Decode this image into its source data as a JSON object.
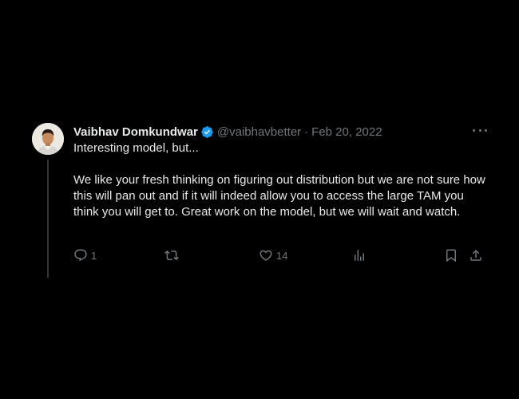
{
  "tweet": {
    "author_name": "Vaibhav Domkundwar",
    "handle": "@vaibhavbetter",
    "separator": "·",
    "date": "Feb 20, 2022",
    "text_line1": "Interesting model, but...",
    "text_para2": "We like your fresh thinking on figuring out distribution but we are not sure how this will pan out and if it will indeed allow you to access the large TAM you think you will get to. Great work on the model, but we will wait and watch."
  },
  "actions": {
    "replies": "1",
    "retweets": "",
    "likes": "14",
    "views": ""
  },
  "icons": {
    "verified": "verified-badge-icon",
    "more": "more-dots-icon",
    "reply": "reply-icon",
    "retweet": "retweet-icon",
    "like": "heart-icon",
    "views": "views-bar-chart-icon",
    "bookmark": "bookmark-icon",
    "share": "share-icon"
  },
  "colors": {
    "background": "#000000",
    "text": "#e7e9ea",
    "muted": "#71767b",
    "verified": "#1d9bf0",
    "thread_line": "#333639"
  }
}
